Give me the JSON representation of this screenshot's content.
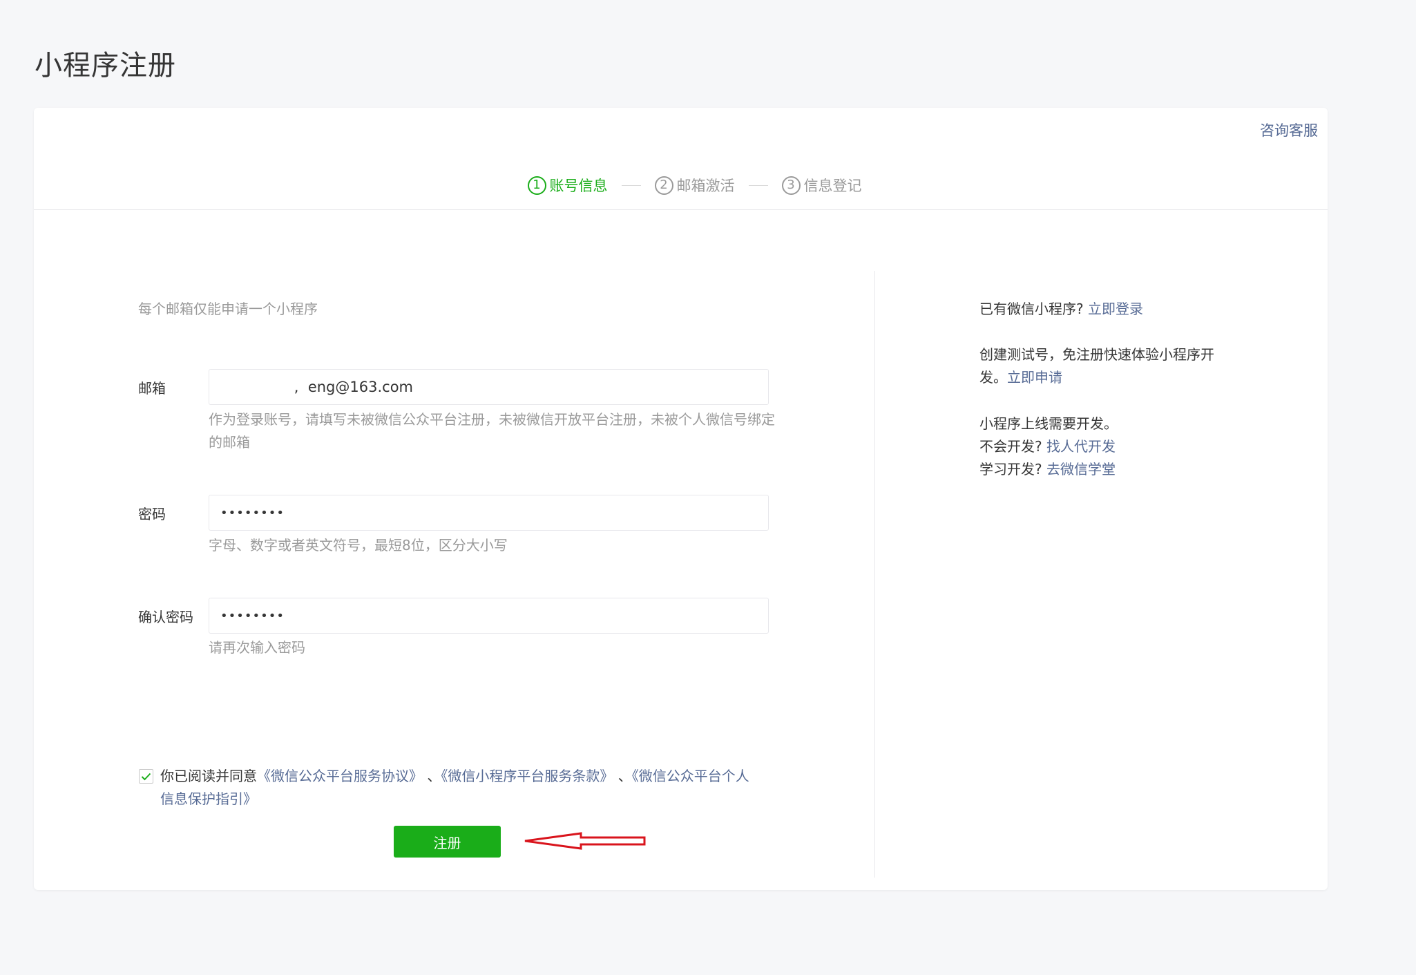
{
  "page": {
    "title": "小程序注册"
  },
  "header": {
    "consult_label": "咨询客服"
  },
  "steps": [
    {
      "num": "1",
      "label": "账号信息"
    },
    {
      "num": "2",
      "label": "邮箱激活"
    },
    {
      "num": "3",
      "label": "信息登记"
    }
  ],
  "form": {
    "tip": "每个邮箱仅能申请一个小程序",
    "email": {
      "label": "邮箱",
      "value": "                ,  eng@163.com",
      "hint": "作为登录账号，请填写未被微信公众平台注册，未被微信开放平台注册，未被个人微信号绑定的邮箱"
    },
    "password": {
      "label": "密码",
      "value": "••••••••",
      "hint": "字母、数字或者英文符号，最短8位，区分大小写"
    },
    "confirm": {
      "label": "确认密码",
      "value": "••••••••",
      "hint": "请再次输入密码"
    },
    "agreement": {
      "checked": true,
      "prefix": "你已阅读并同意",
      "link1": "《微信公众平台服务协议》",
      "sep1": " 、",
      "link2": "《微信小程序平台服务条款》",
      "sep2": " 、",
      "link3": "《微信公众平台个人信息保护指引》"
    },
    "submit_label": "注册"
  },
  "side": {
    "login_prompt": "已有微信小程序?",
    "login_link": "立即登录",
    "test_text": "创建测试号，免注册快速体验小程序开发。",
    "test_link": "立即申请",
    "dev_note": "小程序上线需要开发。",
    "no_dev_prompt": "不会开发?",
    "no_dev_link": "找人代开发",
    "learn_prompt": "学习开发?",
    "learn_link": "去微信学堂"
  },
  "colors": {
    "accent": "#1aad19",
    "link": "#576b95",
    "annotation": "#d9141c"
  }
}
